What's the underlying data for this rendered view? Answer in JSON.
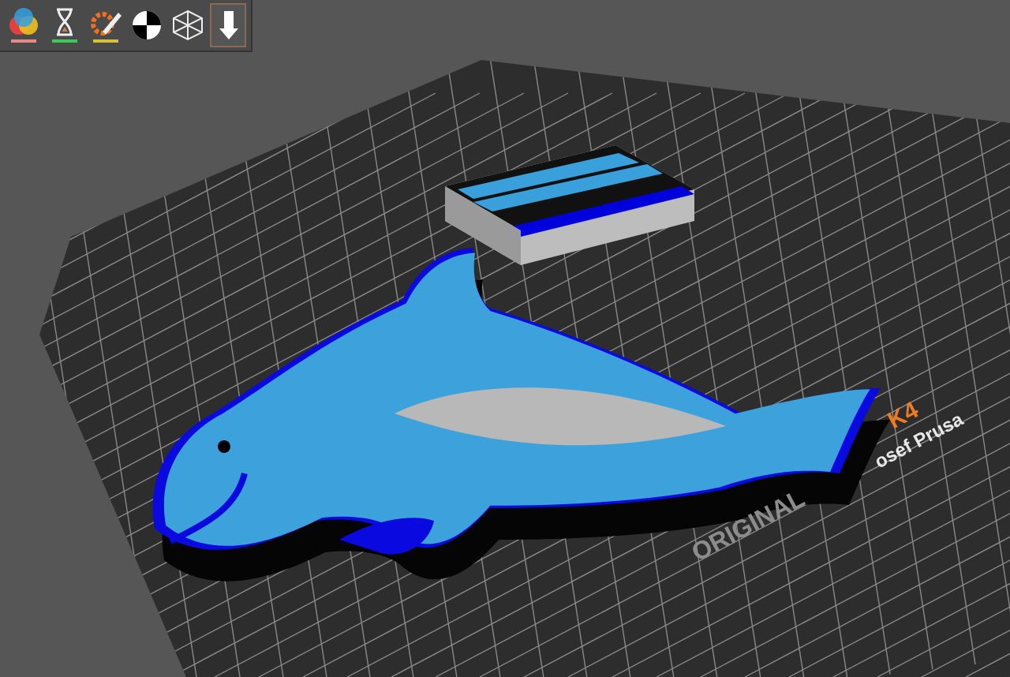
{
  "toolbar": {
    "items": [
      {
        "kind": "color-print",
        "selected": false,
        "color": "#e68a8a"
      },
      {
        "kind": "hourglass",
        "selected": false,
        "color": "#3cc85a"
      },
      {
        "kind": "brush",
        "selected": false,
        "color": "#d6c236"
      },
      {
        "kind": "seam",
        "selected": false
      },
      {
        "kind": "wireframe",
        "selected": false
      },
      {
        "kind": "arrow-down",
        "selected": true
      }
    ]
  },
  "bed": {
    "labels": [
      {
        "kind": "model",
        "text": "K4"
      },
      {
        "kind": "maker",
        "text": "osef Prusa"
      },
      {
        "kind": "brand",
        "text": "ORIGINAL"
      }
    ]
  }
}
